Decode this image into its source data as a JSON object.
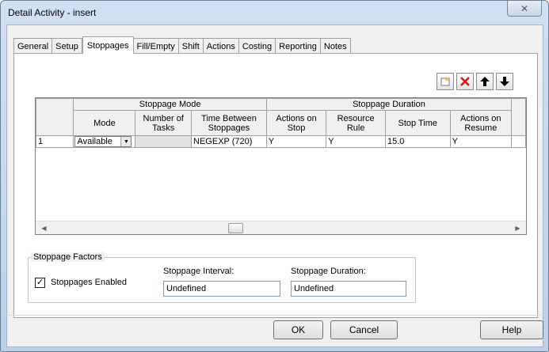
{
  "window": {
    "title": "Detail Activity - insert",
    "close_glyph": "✕"
  },
  "tabs": [
    {
      "label": "General"
    },
    {
      "label": "Setup"
    },
    {
      "label": "Stoppages",
      "active": true
    },
    {
      "label": "Fill/Empty"
    },
    {
      "label": "Shift"
    },
    {
      "label": "Actions"
    },
    {
      "label": "Costing"
    },
    {
      "label": "Reporting"
    },
    {
      "label": "Notes"
    }
  ],
  "toolbar": {
    "new_icon": "new-row-icon",
    "delete_icon": "delete-row-icon",
    "up_icon": "move-up-icon",
    "down_icon": "move-down-icon",
    "delete_color": "#d01818"
  },
  "grid": {
    "group_headers": {
      "mode": "Stoppage Mode",
      "duration": "Stoppage Duration"
    },
    "columns": {
      "mode": "Mode",
      "tasks": "Number of Tasks",
      "between": "Time Between Stoppages",
      "actions_stop": "Actions on Stop",
      "resource": "Resource Rule",
      "stop_time": "Stop Time",
      "actions_resume": "Actions on Resume"
    },
    "rows": [
      {
        "num": "1",
        "mode": "Available",
        "tasks": "",
        "between": "NEGEXP (720)",
        "actions_stop": "Y",
        "resource": "Y",
        "stop_time": "15.0",
        "actions_resume": "Y"
      }
    ]
  },
  "factors": {
    "title": "Stoppage Factors",
    "enabled_label": "Stoppages Enabled",
    "enabled_checked": true,
    "interval_label": "Stoppage Interval:",
    "interval_value": "Undefined",
    "duration_label": "Stoppage Duration:",
    "duration_value": "Undefined"
  },
  "buttons": {
    "ok": "OK",
    "cancel": "Cancel",
    "help": "Help"
  }
}
